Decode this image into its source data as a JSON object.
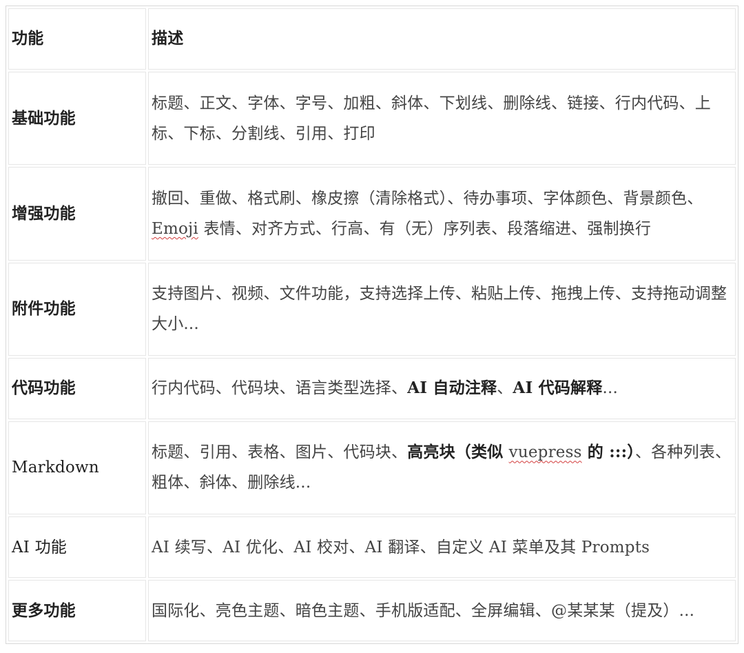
{
  "table": {
    "header": {
      "feature": "功能",
      "description": "描述"
    },
    "rows": [
      {
        "feature": "基础功能",
        "description": "标题、正文、字体、字号、加粗、斜体、下划线、删除线、链接、行内代码、上标、下标、分割线、引用、打印"
      },
      {
        "feature": "增强功能",
        "desc_a": "撤回、重做、格式刷、橡皮擦（清除格式）、待办事项、字体颜色、背景颜色、",
        "desc_b": "Emoji",
        "desc_c": " 表情、对齐方式、行高、有（无）序列表、段落缩进、强制换行"
      },
      {
        "feature": "附件功能",
        "description": "支持图片、视频、文件功能，支持选择上传、粘贴上传、拖拽上传、支持拖动调整大小..."
      },
      {
        "feature": "代码功能",
        "desc_a": "行内代码、代码块、语言类型选择、",
        "desc_b": "AI 自动注释",
        "desc_c": "、",
        "desc_d": "AI 代码解释",
        "desc_e": "..."
      },
      {
        "feature": "Markdown",
        "desc_a": "标题、引用、表格、图片、代码块、",
        "desc_b": "高亮块（类似 ",
        "desc_c": "vuepress",
        "desc_d": " 的 :::）",
        "desc_e": "、各种列表、粗体、斜体、删除线..."
      },
      {
        "feature": "AI 功能",
        "description": "AI 续写、AI 优化、AI 校对、AI 翻译、自定义 AI 菜单及其 Prompts"
      },
      {
        "feature": "更多功能",
        "description": "国际化、亮色主题、暗色主题、手机版适配、全屏编辑、@某某某（提及）..."
      }
    ]
  }
}
